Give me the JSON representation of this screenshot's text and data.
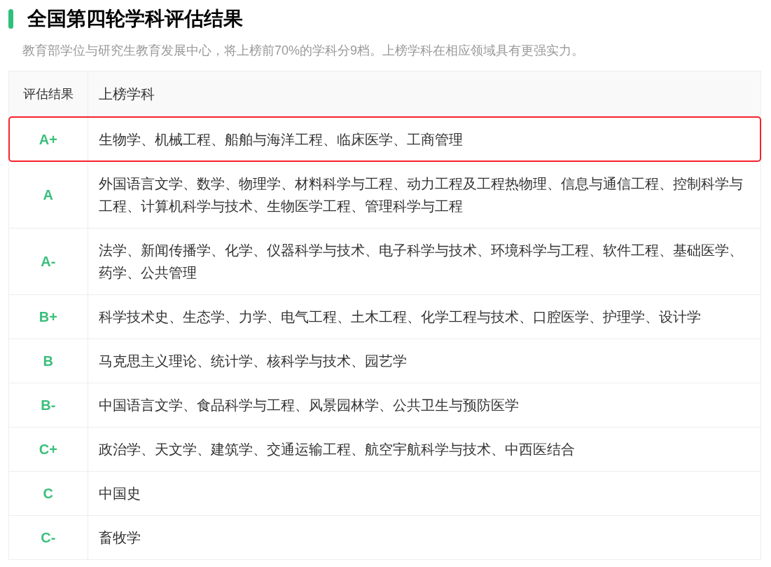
{
  "title": "全国第四轮学科评估结果",
  "subtitle": "教育部学位与研究生教育发展中心，将上榜前70%的学科分9档。上榜学科在相应领域具有更强实力。",
  "table": {
    "columns": [
      "评估结果",
      "上榜学科"
    ],
    "rows": [
      {
        "grade": "A+",
        "subjects": "生物学、机械工程、船舶与海洋工程、临床医学、工商管理",
        "highlighted": true
      },
      {
        "grade": "A",
        "subjects": "外国语言文学、数学、物理学、材料科学与工程、动力工程及工程热物理、信息与通信工程、控制科学与工程、计算机科学与技术、生物医学工程、管理科学与工程",
        "highlighted": false
      },
      {
        "grade": "A-",
        "subjects": "法学、新闻传播学、化学、仪器科学与技术、电子科学与技术、环境科学与工程、软件工程、基础医学、药学、公共管理",
        "highlighted": false
      },
      {
        "grade": "B+",
        "subjects": "科学技术史、生态学、力学、电气工程、土木工程、化学工程与技术、口腔医学、护理学、设计学",
        "highlighted": false
      },
      {
        "grade": "B",
        "subjects": "马克思主义理论、统计学、核科学与技术、园艺学",
        "highlighted": false
      },
      {
        "grade": "B-",
        "subjects": "中国语言文学、食品科学与工程、风景园林学、公共卫生与预防医学",
        "highlighted": false
      },
      {
        "grade": "C+",
        "subjects": "政治学、天文学、建筑学、交通运输工程、航空宇航科学与技术、中西医结合",
        "highlighted": false
      },
      {
        "grade": "C",
        "subjects": "中国史",
        "highlighted": false
      },
      {
        "grade": "C-",
        "subjects": "畜牧学",
        "highlighted": false
      }
    ]
  }
}
